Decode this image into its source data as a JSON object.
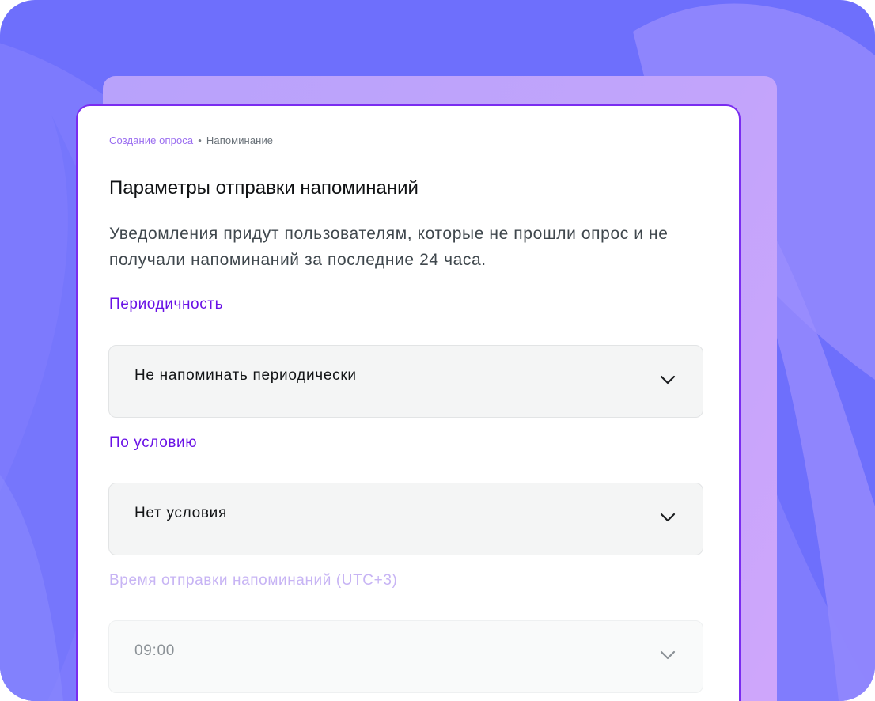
{
  "breadcrumb": {
    "parent": "Создание опроса",
    "separator": "•",
    "current": "Напоминание"
  },
  "page_title": "Параметры отправки напоминаний",
  "description": "Уведомления придут пользователям, которые не прошли опрос и не получали напоминаний за последние 24 часа.",
  "fields": {
    "periodicity": {
      "label": "Периодичность",
      "value": "Не напоминать периодически"
    },
    "condition": {
      "label": "По условию",
      "value": "Нет условия"
    },
    "send_time": {
      "label": "Время отправки напоминаний (UTC+3)",
      "value": "09:00",
      "disabled": true
    }
  },
  "icons": {
    "dropdown": "chevron-down-icon"
  },
  "colors": {
    "background": "#6e6ffc",
    "accent": "#7a2cf0",
    "label": "#6a12e6",
    "label_disabled": "#c7b4f4",
    "field_bg": "#f4f5f5"
  }
}
